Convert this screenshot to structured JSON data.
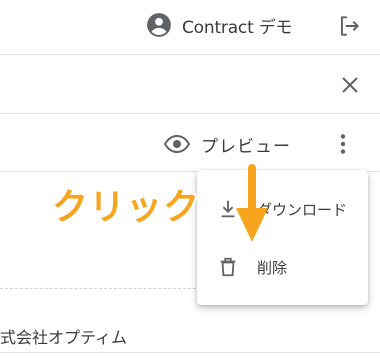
{
  "header": {
    "user_name": "Contract デモ"
  },
  "toolbar": {
    "preview_label": "プレビュー"
  },
  "menu": {
    "items": [
      {
        "label": "ダウンロード",
        "icon": "download-icon"
      },
      {
        "label": "削除",
        "icon": "delete-icon"
      }
    ]
  },
  "content": {
    "company_fragment": "式会社オプティム"
  },
  "annotation": {
    "callout_text": "クリック",
    "color": "#f7a51f"
  }
}
